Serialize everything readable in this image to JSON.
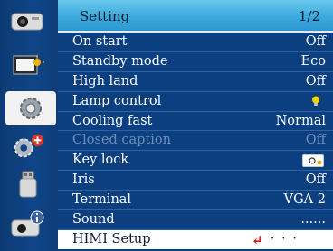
{
  "header": {
    "title": "Setting",
    "page": "1/2"
  },
  "sidebar": {
    "icons": [
      {
        "name": "picture-icon"
      },
      {
        "name": "display-icon"
      },
      {
        "name": "setting-gear-icon"
      },
      {
        "name": "expanded-setting-icon"
      },
      {
        "name": "usb-memory-icon"
      },
      {
        "name": "information-icon"
      }
    ]
  },
  "rows": [
    {
      "label": "On start",
      "value": "Off"
    },
    {
      "label": "Standby mode",
      "value": "Eco"
    },
    {
      "label": "High land",
      "value": "Off"
    },
    {
      "label": "Lamp control",
      "value": ""
    },
    {
      "label": "Cooling fast",
      "value": "Normal"
    },
    {
      "label": "Closed caption",
      "value": "Off"
    },
    {
      "label": "Key lock",
      "value": ""
    },
    {
      "label": "Iris",
      "value": "Off"
    },
    {
      "label": "Terminal",
      "value": "VGA 2"
    },
    {
      "label": "Sound",
      "value": "......"
    },
    {
      "label": "HIMI Setup",
      "value": "· · ·"
    }
  ],
  "colors": {
    "background": "#0b3f80",
    "header": "#3aa9dc",
    "selection": "#ffffff",
    "accent": "#d9141b"
  }
}
